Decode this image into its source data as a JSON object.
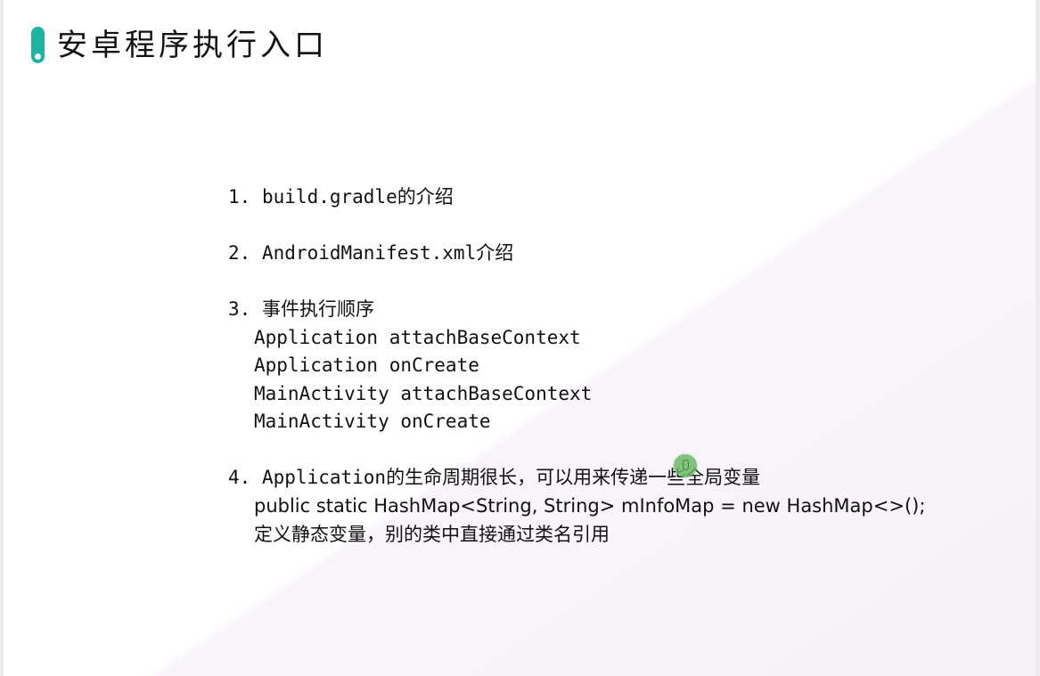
{
  "slide": {
    "title": "安卓程序执行入口",
    "items": [
      {
        "number": "1.",
        "heading": "build.gradle的介绍"
      },
      {
        "number": "2.",
        "heading": "AndroidManifest.xml介绍"
      },
      {
        "number": "3.",
        "heading": "事件执行顺序",
        "lines": [
          "Application attachBaseContext",
          "Application onCreate",
          "MainActivity attachBaseContext",
          "MainActivity onCreate"
        ]
      },
      {
        "number": "4.",
        "heading": "Application的生命周期很长，可以用来传递一些全局变量",
        "lines": [
          "public static HashMap<String, String> mInfoMap = new HashMap<>();",
          "定义静态变量，别的类中直接通过类名引用"
        ]
      }
    ]
  },
  "colors": {
    "accent": "#1fb3a5",
    "cursor": "#66b860",
    "background_tint": "#f6f2f8"
  }
}
